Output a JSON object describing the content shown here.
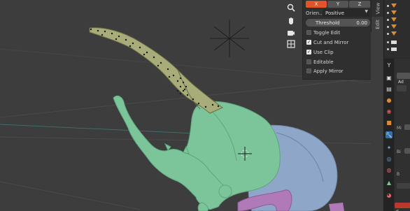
{
  "mirror_panel": {
    "axes": [
      "X",
      "Y",
      "Z"
    ],
    "active_axis": "X",
    "orientation_label": "Orien...",
    "orientation_value": "Positive",
    "threshold_label": "Threshold",
    "threshold_value": "0.00",
    "checkboxes": [
      {
        "label": "Toggle Edit",
        "checked": false
      },
      {
        "label": "Cut and Mirror",
        "checked": true
      },
      {
        "label": "Use Clip",
        "checked": true
      },
      {
        "label": "Editable",
        "checked": false
      },
      {
        "label": "Apply Mirror",
        "checked": false
      }
    ]
  },
  "sidebar_tabs": {
    "view": "View",
    "edit": "Edit"
  },
  "nav_icons": [
    "zoom-icon",
    "hand-pan-icon",
    "camera-icon",
    "grid-view-icon"
  ],
  "properties": {
    "tab_partial_label": "Ad",
    "label_mi": "Mi",
    "label_bi": "Bi",
    "label_b": "B",
    "label_c": "C"
  },
  "colors": {
    "viewport_bg": "#3d3d3d",
    "axis_active": "#e0552e",
    "mesh_green": "#7cc49a",
    "mesh_blue": "#8ea7c8",
    "mesh_purple": "#b07ab8",
    "outliner_icon": "#e08a2c"
  }
}
